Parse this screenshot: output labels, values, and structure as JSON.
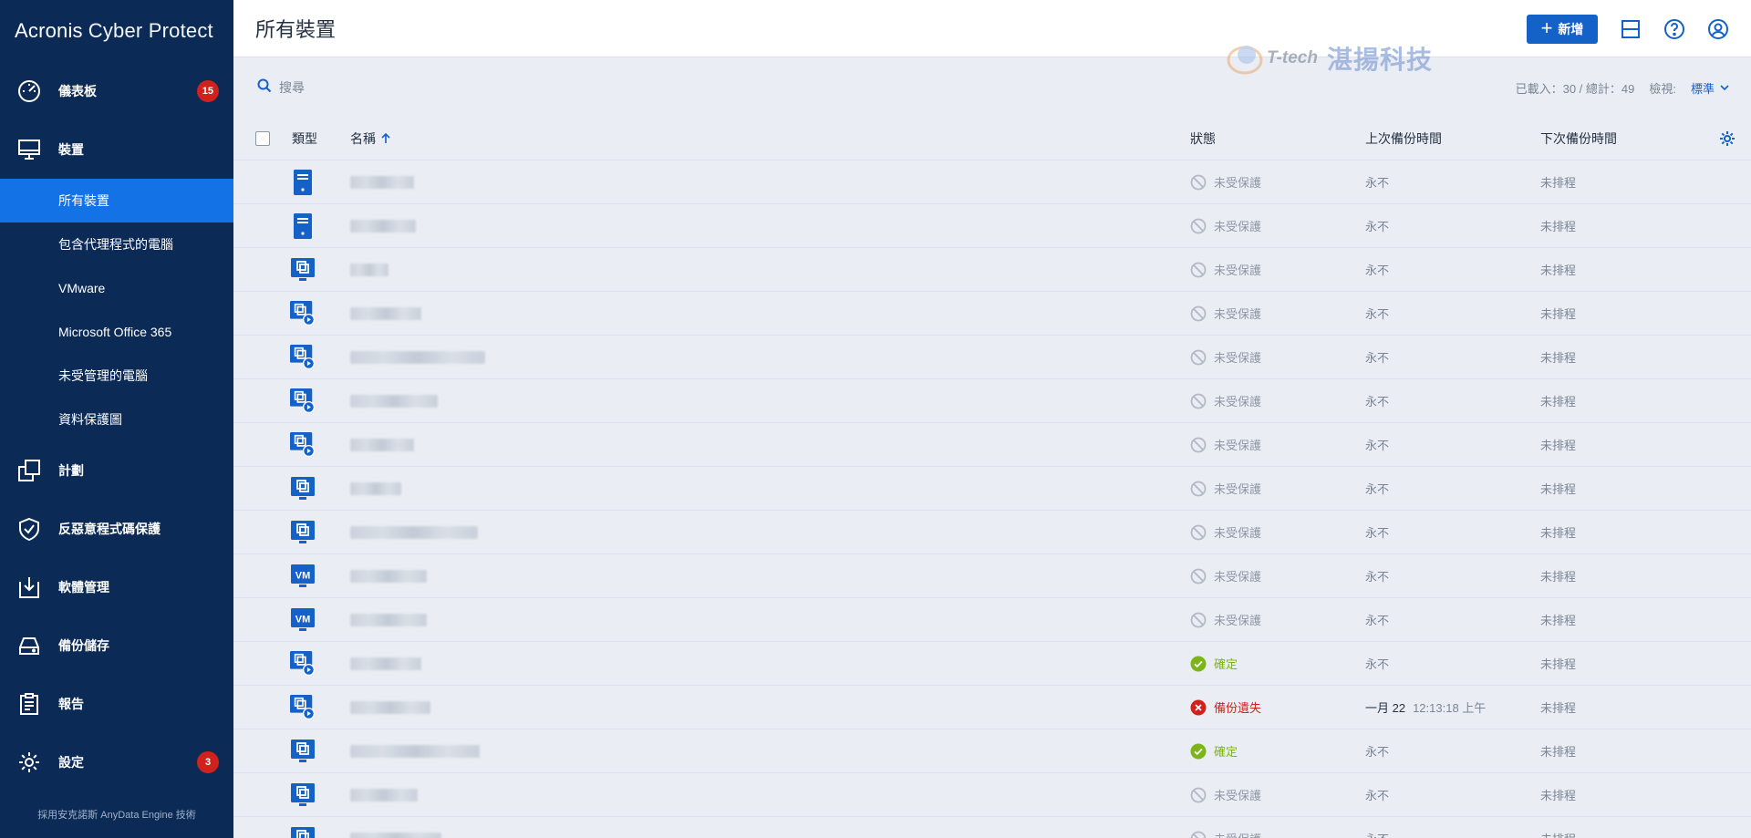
{
  "app": {
    "brand_primary": "Acronis",
    "brand_secondary": "Cyber Protect"
  },
  "sidebar": {
    "items": [
      {
        "label": "儀表板",
        "icon": "gauge-icon",
        "badge": "15"
      },
      {
        "label": "裝置",
        "icon": "monitor-icon",
        "badge": ""
      },
      {
        "label": "計劃",
        "icon": "plans-icon",
        "badge": ""
      },
      {
        "label": "反惡意程式碼保護",
        "icon": "shield-icon",
        "badge": ""
      },
      {
        "label": "軟體管理",
        "icon": "software-icon",
        "badge": ""
      },
      {
        "label": "備份儲存",
        "icon": "storage-icon",
        "badge": ""
      },
      {
        "label": "報告",
        "icon": "report-icon",
        "badge": ""
      },
      {
        "label": "設定",
        "icon": "gear-icon",
        "badge": "3"
      }
    ],
    "subitems": [
      {
        "label": "所有裝置",
        "active": true
      },
      {
        "label": "包含代理程式的電腦",
        "active": false
      },
      {
        "label": "VMware",
        "active": false
      },
      {
        "label": "Microsoft Office 365",
        "active": false
      },
      {
        "label": "未受管理的電腦",
        "active": false
      },
      {
        "label": "資料保護圖",
        "active": false
      }
    ],
    "footer": "採用安克諾斯 AnyData Engine 技術"
  },
  "header": {
    "title": "所有裝置",
    "new_button": "新增"
  },
  "watermark": {
    "latin": "T-tech",
    "cjk": "湛揚科技"
  },
  "toolbar": {
    "search_placeholder": "搜尋",
    "loaded_text": "已載入：30 / 總計：49",
    "view_label": "檢視:",
    "view_value": "標準"
  },
  "table": {
    "columns": {
      "type": "類型",
      "name": "名稱",
      "status": "狀態",
      "last_backup": "上次備份時間",
      "next_backup": "下次備份時間"
    },
    "rows": [
      {
        "type_icon": "server-icon",
        "name": "",
        "status": "未受保護",
        "status_kind": "unprotected",
        "last": "永不",
        "last_time": "",
        "next": "未排程"
      },
      {
        "type_icon": "server-icon",
        "name": "",
        "status": "未受保護",
        "status_kind": "unprotected",
        "last": "永不",
        "last_time": "",
        "next": "未排程"
      },
      {
        "type_icon": "machine-icon",
        "name": "",
        "status": "未受保護",
        "status_kind": "unprotected",
        "last": "永不",
        "last_time": "",
        "next": "未排程"
      },
      {
        "type_icon": "agent-machine-icon",
        "name": "",
        "status": "未受保護",
        "status_kind": "unprotected",
        "last": "永不",
        "last_time": "",
        "next": "未排程"
      },
      {
        "type_icon": "agent-machine-icon",
        "name": "",
        "status": "未受保護",
        "status_kind": "unprotected",
        "last": "永不",
        "last_time": "",
        "next": "未排程"
      },
      {
        "type_icon": "agent-machine-icon",
        "name": "",
        "status": "未受保護",
        "status_kind": "unprotected",
        "last": "永不",
        "last_time": "",
        "next": "未排程"
      },
      {
        "type_icon": "agent-machine-icon",
        "name": "",
        "status": "未受保護",
        "status_kind": "unprotected",
        "last": "永不",
        "last_time": "",
        "next": "未排程"
      },
      {
        "type_icon": "machine-icon",
        "name": "",
        "status": "未受保護",
        "status_kind": "unprotected",
        "last": "永不",
        "last_time": "",
        "next": "未排程"
      },
      {
        "type_icon": "machine-icon",
        "name": "",
        "status": "未受保護",
        "status_kind": "unprotected",
        "last": "永不",
        "last_time": "",
        "next": "未排程"
      },
      {
        "type_icon": "vm-icon",
        "name": "",
        "status": "未受保護",
        "status_kind": "unprotected",
        "last": "永不",
        "last_time": "",
        "next": "未排程"
      },
      {
        "type_icon": "vm-icon",
        "name": "",
        "status": "未受保護",
        "status_kind": "unprotected",
        "last": "永不",
        "last_time": "",
        "next": "未排程"
      },
      {
        "type_icon": "agent-machine-icon",
        "name": "",
        "status": "確定",
        "status_kind": "ok",
        "last": "永不",
        "last_time": "",
        "next": "未排程"
      },
      {
        "type_icon": "agent-machine-icon",
        "name": "",
        "status": "備份遺失",
        "status_kind": "failed",
        "last": "一月 22",
        "last_time": "12:13:18 上午",
        "next": "未排程"
      },
      {
        "type_icon": "machine-icon",
        "name": "",
        "status": "確定",
        "status_kind": "ok",
        "last": "永不",
        "last_time": "",
        "next": "未排程"
      },
      {
        "type_icon": "machine-icon",
        "name": "",
        "status": "未受保護",
        "status_kind": "unprotected",
        "last": "永不",
        "last_time": "",
        "next": "未排程"
      },
      {
        "type_icon": "machine-icon",
        "name": "",
        "status": "未受保護",
        "status_kind": "unprotected",
        "last": "永不",
        "last_time": "",
        "next": "未排程"
      }
    ]
  },
  "colors": {
    "sidebar_bg": "#0b2a55",
    "active_item": "#1373e6",
    "accent": "#1461c8",
    "badge": "#d0221c",
    "ok": "#7cb518",
    "failed": "#d0221c",
    "unprotected": "#8e97a6"
  }
}
